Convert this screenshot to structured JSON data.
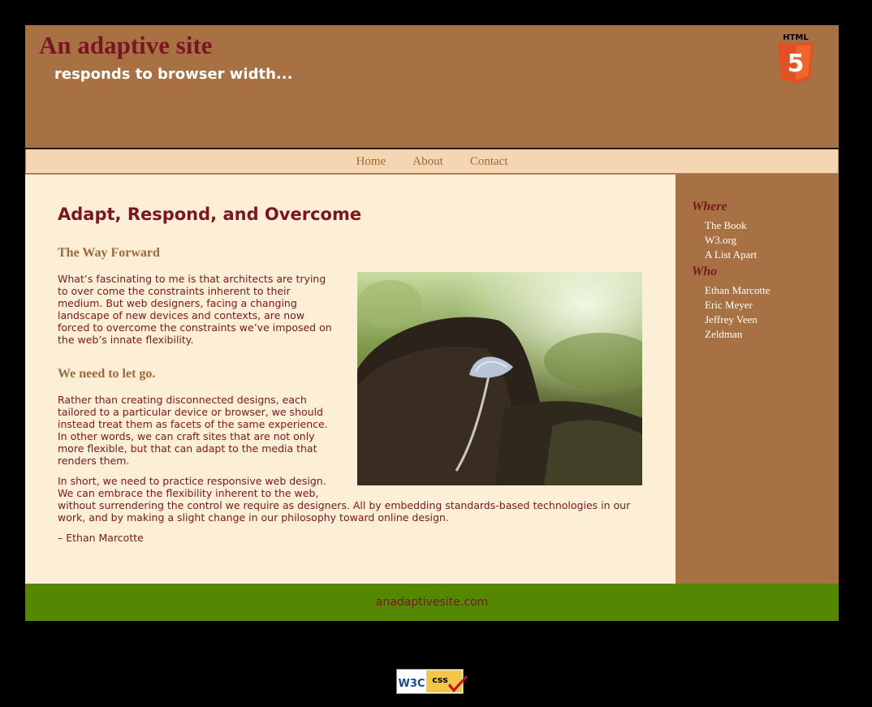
{
  "header": {
    "title": "An adaptive site",
    "tagline": "responds to browser width...",
    "html5_badge_text": "HTML",
    "html5_badge_number": "5"
  },
  "nav": {
    "items": [
      {
        "label": "Home"
      },
      {
        "label": "About"
      },
      {
        "label": "Contact"
      }
    ]
  },
  "main": {
    "heading": "Adapt, Respond, and Overcome",
    "section1_title": "The Way Forward",
    "section1_text": "What’s fascinating to me is that architects are trying to over come the constraints inherent to their medium. But web designers, facing a changing landscape of new devices and contexts, are now forced to overcome the constraints we’ve imposed on the web’s innate flexibility.",
    "section2_title": "We need to let go.",
    "section2_text": "Rather than creating disconnected designs, each tailored to a particular device or browser, we should instead treat them as facets of the same experience. In other words, we can craft sites that are not only more flexible, but that can adapt to the media that renders them.",
    "section3_text": "In short, we need to practice responsive web design. We can embrace the flexibility inherent to the web, without surrendering the control we require as designers. All by embedding standards-based technologies in our work, and by making a slight change in our philosophy toward online design.",
    "signature": "– Ethan Marcotte"
  },
  "sidebar": {
    "where_title": "Where",
    "where_links": [
      {
        "label": "The Book"
      },
      {
        "label": "W3.org"
      },
      {
        "label": "A List Apart"
      }
    ],
    "who_title": "Who",
    "who_links": [
      {
        "label": "Ethan Marcotte"
      },
      {
        "label": "Eric Meyer"
      },
      {
        "label": "Jeffrey Veen"
      },
      {
        "label": "Zeldman"
      }
    ]
  },
  "footer": {
    "text": "anadaptivesite.com"
  },
  "badge": {
    "w3c": "W3C",
    "css": "css"
  },
  "colors": {
    "header_bg": "#a87143",
    "title": "#7a1621",
    "nav_bg": "#f5d6b2",
    "content_bg": "#fdeed6",
    "footer_bg": "#548802",
    "page_bg": "#000000"
  }
}
